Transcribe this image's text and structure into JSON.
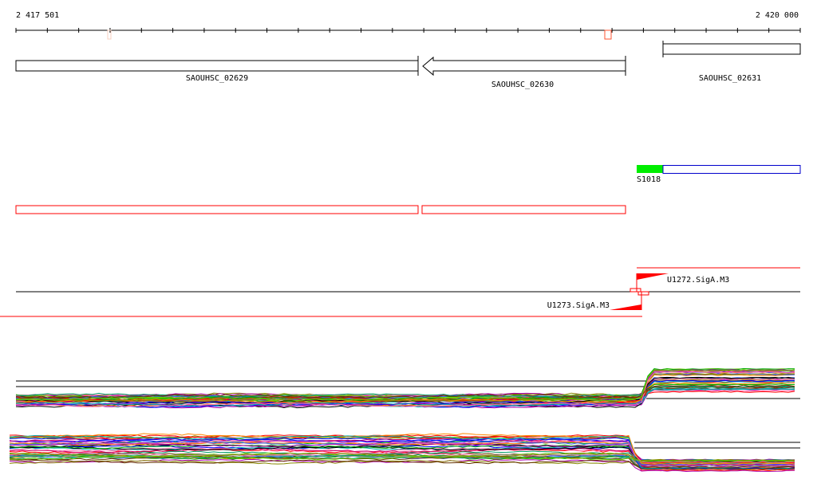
{
  "ruler": {
    "start_label": "2 417 501",
    "end_label": "2 420 000",
    "tick_count": 25
  },
  "genes": [
    {
      "name": "SAOUHSC_02629"
    },
    {
      "name": "SAOUHSC_02630"
    },
    {
      "name": "SAOUHSC_02631"
    }
  ],
  "segment": {
    "label": "S1018",
    "fill_color": "#00ee00",
    "border_color": "#0000cc"
  },
  "promoters": [
    {
      "label": "U1272.SigA.M3",
      "strand": "+"
    },
    {
      "label": "U1273.SigA.M3",
      "strand": "-"
    }
  ],
  "colors": {
    "feature": "#ff0000",
    "line": "#000000"
  }
}
